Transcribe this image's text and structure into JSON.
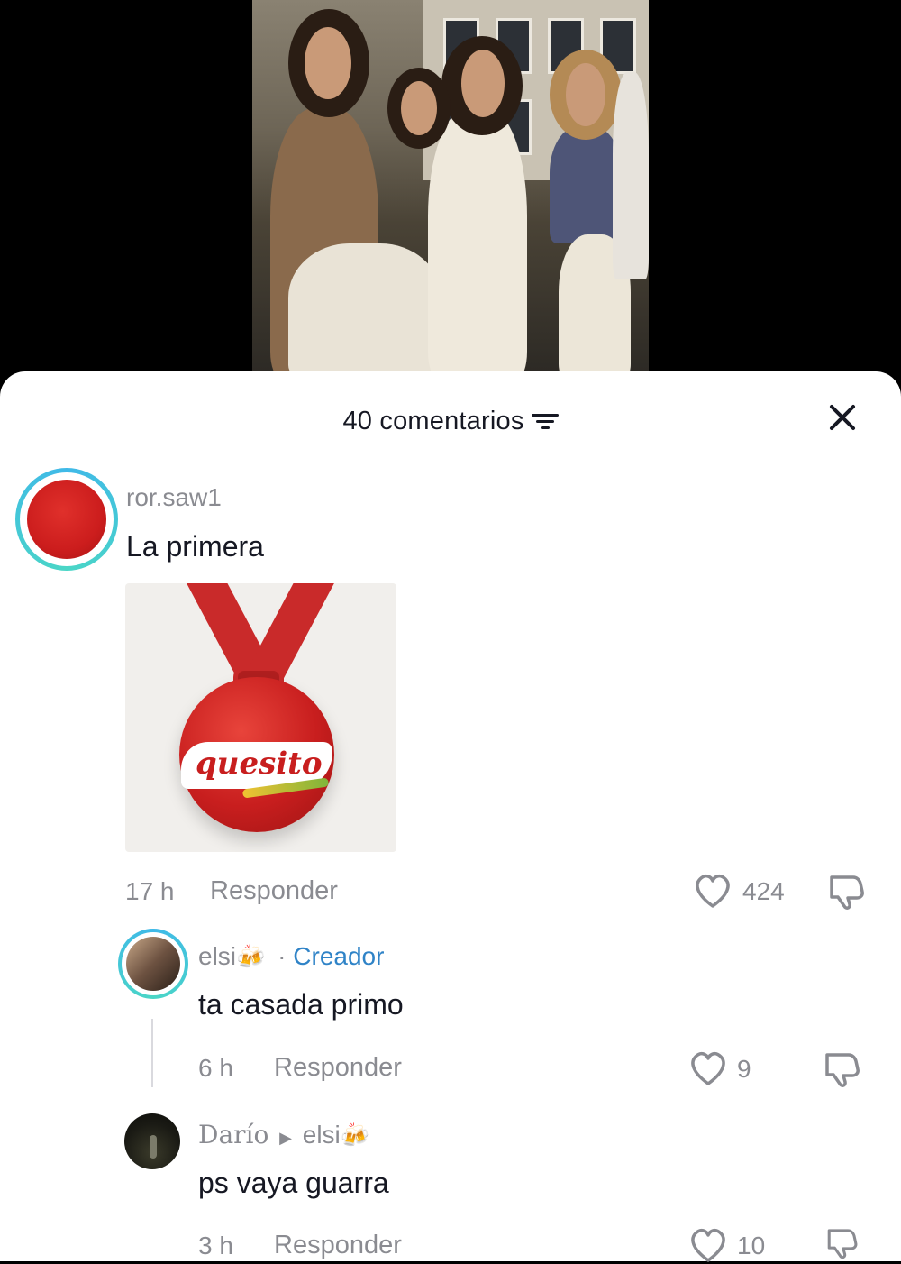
{
  "header": {
    "comment_count": "40 comentarios"
  },
  "comments": [
    {
      "username": "ror.saw1",
      "text": "La primera",
      "sticker_word": "quesito",
      "time": "17 h",
      "reply_label": "Responder",
      "likes": "424",
      "avatar_color": "#d21f1f"
    },
    {
      "username": "elsi",
      "username_emoji": "🍻",
      "separator": "·",
      "badge": "Creador",
      "text": "ta casada primo",
      "time": "6 h",
      "reply_label": "Responder",
      "likes": "9"
    },
    {
      "username": "Darío",
      "reply_to": "elsi",
      "reply_to_emoji": "🍻",
      "text": "ps vaya guarra",
      "time": "3 h",
      "reply_label": "Responder",
      "likes": "10"
    }
  ],
  "colors": {
    "accent_link": "#2f83c7",
    "muted": "#8a8b91",
    "text": "#161823"
  },
  "icons": [
    "sort-icon",
    "close-icon",
    "heart-icon",
    "dislike-icon",
    "arrow-right-icon"
  ]
}
